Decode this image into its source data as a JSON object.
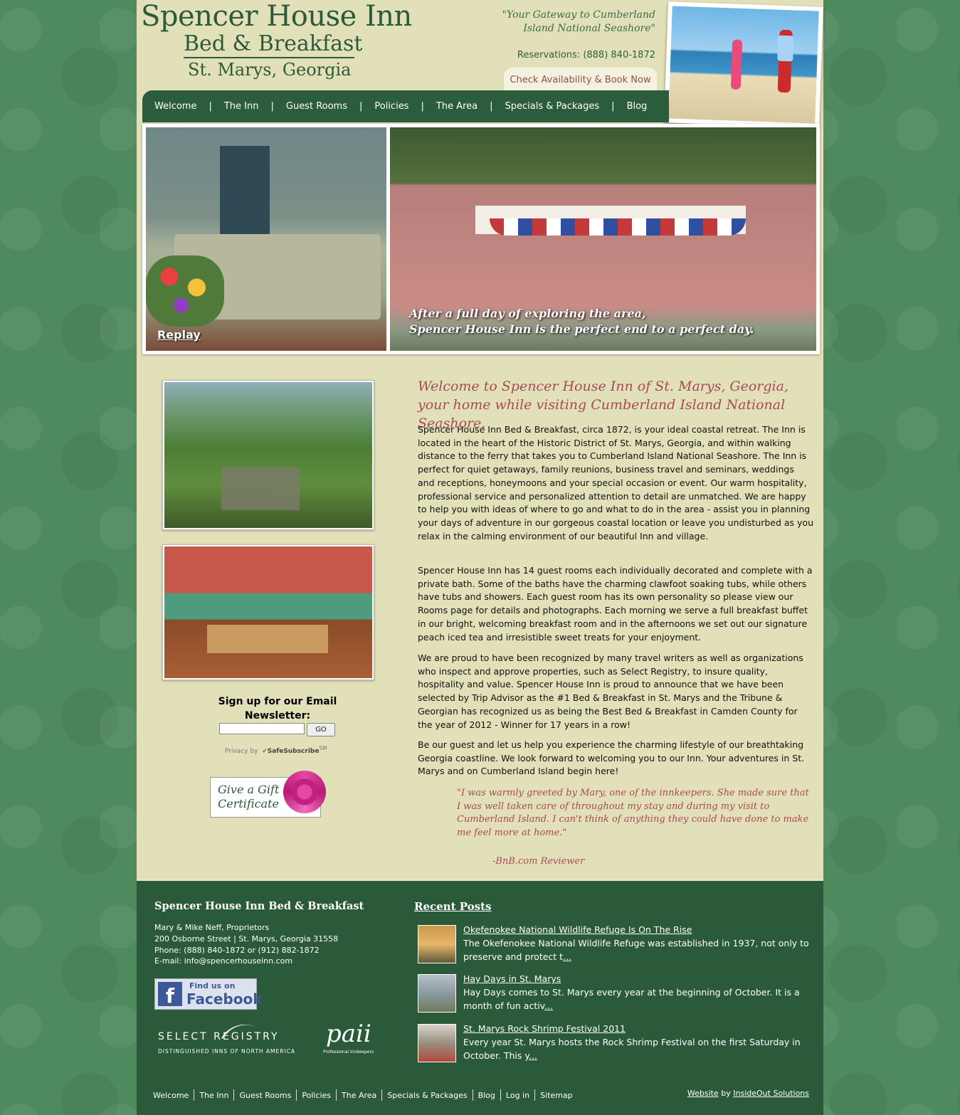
{
  "header": {
    "logo_line1": "Spencer House Inn",
    "logo_line2": "Bed & Breakfast",
    "logo_line3": "St. Marys, Georgia",
    "tagline": "\"Your Gateway to Cumberland Island National Seashore\"",
    "reservations": "Reservations: (888) 840-1872",
    "book_button": "Check Availability & Book Now"
  },
  "nav": {
    "items": [
      "Welcome",
      "The Inn",
      "Guest Rooms",
      "Policies",
      "The Area",
      "Specials & Packages",
      "Blog"
    ]
  },
  "hero": {
    "replay": "Replay",
    "caption_line1": "After a full day of exploring the area,",
    "caption_line2": "Spencer House Inn is the perfect end to a perfect day."
  },
  "sidebar": {
    "newsletter_title": "Sign up for our Email Newsletter:",
    "go_button": "GO",
    "privacy_prefix": "Privacy by",
    "privacy_brand": "SafeSubscribe",
    "privacy_mark": "SM",
    "gift_line1": "Give a Gift",
    "gift_line2": "Certificate"
  },
  "main": {
    "welcome_title": "Welcome to Spencer House Inn of St. Marys, Georgia, your home while visiting Cumberland Island National Seashore.",
    "paragraphs": [
      "Spencer House Inn Bed & Breakfast, circa 1872, is your ideal coastal retreat. The Inn is located in the heart of the Historic District of St. Marys, Georgia, and within walking distance to the ferry that takes you to Cumberland Island National Seashore. The Inn is perfect for quiet getaways, family reunions, business travel and seminars, weddings and receptions, honeymoons and your special occasion or event. Our warm hospitality, professional service and personalized attention to detail are unmatched. We are happy to help you with ideas of where to go and what to do in the area - assist you in planning your days of adventure in our gorgeous coastal location or leave you undisturbed as you relax in the calming environment of our beautiful Inn and village.",
      "Spencer House Inn has 14 guest rooms each individually decorated and complete with a private bath. Some of the baths have the charming clawfoot soaking tubs, while others have tubs and showers. Each guest room has its own personality so please view our Rooms page for details and photographs. Each morning we serve a full breakfast buffet in our bright, welcoming breakfast room and in the afternoons we set out our signature peach iced tea and irresistible sweet treats for your enjoyment.",
      "We are proud to have been recognized by many travel writers as well as organizations who inspect and approve properties, such as Select Registry, to insure quality, hospitality and value. Spencer House Inn is proud to announce that we have been selected by Trip Advisor as the #1 Bed & Breakfast in St. Marys and the Tribune & Georgian has recognized us as being the Best Bed & Breakfast in Camden County for the year of 2012 - Winner for 17 years in a row!",
      "Be our guest and let us help you experience the charming lifestyle of our breathtaking Georgia coastline. We look forward to welcoming you to our Inn. Your adventures in St. Marys and on Cumberland Island begin here!"
    ],
    "testimonial": "\"I was warmly greeted by Mary, one of the innkeepers. She made sure that I was well taken care of throughout my stay and during my visit to Cumberland Island. I can't think of anything they could have done to make me feel more at home.\"",
    "testimonial_author": "-BnB.com Reviewer"
  },
  "footer": {
    "title": "Spencer House Inn Bed & Breakfast",
    "proprietors": "Mary & Mike Neff, Proprietors",
    "address": "200 Osborne Street | St. Marys, Georgia 31558",
    "phone": "Phone: (888) 840-1872 or (912) 882-1872",
    "email": "E-mail: info@spencerhouseinn.com",
    "facebook_line1": "Find us on",
    "facebook_line2": "Facebook",
    "select_registry": "SELECT REGISTRY",
    "select_registry_sub": "DISTINGUISHED INNS OF NORTH AMERICA",
    "paii": "paii",
    "paii_sub": "Professional Innkeepers",
    "recent_posts_title": "Recent Posts",
    "posts": [
      {
        "title": "Okefenokee National Wildlife Refuge Is On The Rise",
        "excerpt": "The Okefenokee National Wildlife Refuge was established in 1937, not only to preserve and protect t",
        "more": "..."
      },
      {
        "title": "Hay Days in St. Marys",
        "excerpt": " Hay Days comes to St. Marys every year at the beginning of October. It is a month of fun activ",
        "more": "..."
      },
      {
        "title": "St. Marys Rock Shrimp Festival 2011",
        "excerpt": "Every year St. Marys hosts the Rock Shrimp Festival on the first Saturday in October. This y",
        "more": "..."
      }
    ],
    "nav": [
      "Welcome",
      "The Inn",
      "Guest Rooms",
      "Policies",
      "The Area",
      "Specials & Packages",
      "Blog",
      "Log in",
      "Sitemap"
    ],
    "credit_link": "Website",
    "credit_by": " by ",
    "credit_company": "InsideOut Solutions"
  },
  "colors": {
    "background_green": "#4e8a5d",
    "panel_cream": "#e2e0b8",
    "nav_green": "#2b5c3b",
    "accent_rose": "#a84a55"
  }
}
